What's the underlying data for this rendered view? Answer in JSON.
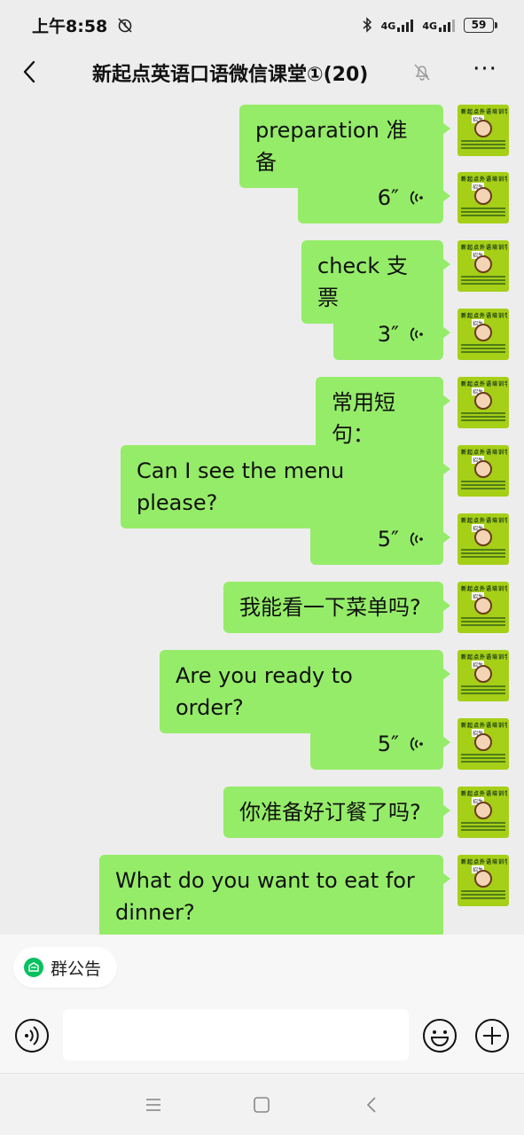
{
  "status_bar": {
    "time": "上午8:58",
    "net1": "4G",
    "net2": "4G",
    "battery": "59"
  },
  "header": {
    "title": "新起点英语口语微信课堂①(20)",
    "more": "···"
  },
  "avatar": {
    "arc_text": "新起点外语培训学校",
    "label": "招生"
  },
  "messages": [
    {
      "type": "text",
      "text": "preparation 准备"
    },
    {
      "type": "voice",
      "duration": "6″"
    },
    {
      "type": "text",
      "text": "check 支票"
    },
    {
      "type": "voice",
      "duration": "3″"
    },
    {
      "type": "text",
      "text": "常用短句："
    },
    {
      "type": "text",
      "text": "Can I see the menu please?"
    },
    {
      "type": "voice",
      "duration": "5″"
    },
    {
      "type": "text",
      "text": "我能看一下菜单吗?"
    },
    {
      "type": "text",
      "text": "Are you ready to order?"
    },
    {
      "type": "voice",
      "duration": "5″"
    },
    {
      "type": "text",
      "text": "你准备好订餐了吗?"
    },
    {
      "type": "text",
      "text": "What  do you want to eat for dinner?"
    }
  ],
  "announcement": {
    "label": "群公告"
  },
  "input": {
    "value": ""
  },
  "icons": {
    "back": "chevron-left-icon",
    "mute": "bell-off-icon",
    "voice": "voice-wave-icon",
    "emoji": "smiley-icon",
    "plus": "plus-circle-icon"
  },
  "colors": {
    "bubble": "#95ec69",
    "background": "#ededed",
    "avatar": "#a6cf17",
    "announce_icon": "#07c160"
  }
}
